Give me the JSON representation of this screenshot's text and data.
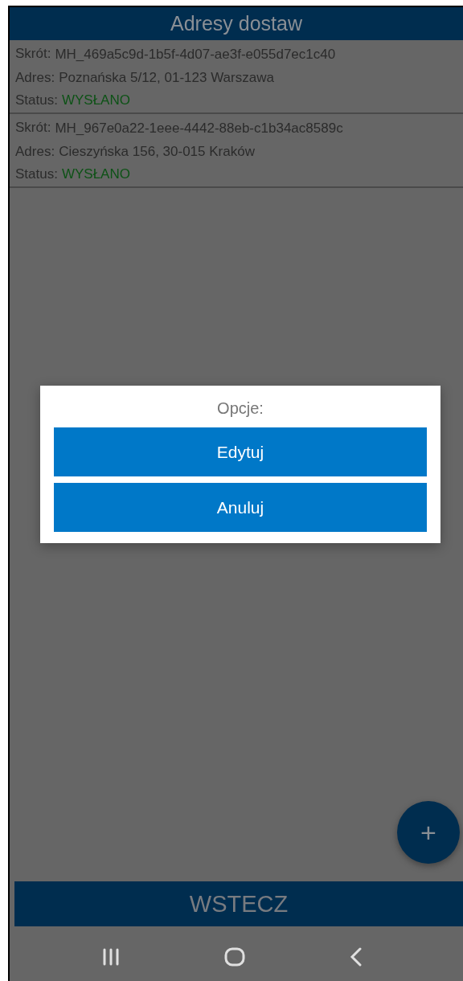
{
  "header": {
    "title": "Adresy dostaw"
  },
  "addresses": [
    {
      "code_label": "Skrót:",
      "code": "MH_469a5c9d-1b5f-4d07-ae3f-e055d7ec1c40",
      "address_label": "Adres:",
      "address": "Poznańska 5/12, 01-123 Warszawa",
      "status_label": "Status:",
      "status": "WYSŁANO"
    },
    {
      "code_label": "Skrót:",
      "code": "MH_967e0a22-1eee-4442-88eb-c1b34ac8589c",
      "address_label": "Adres:",
      "address": "Cieszyńska 156, 30-015 Kraków",
      "status_label": "Status:",
      "status": "WYSŁANO"
    }
  ],
  "dialog": {
    "title": "Opcje:",
    "buttons": [
      "Edytuj",
      "Anuluj"
    ]
  },
  "fab": {
    "label": "+"
  },
  "back_button": {
    "label": "WSTECZ"
  }
}
